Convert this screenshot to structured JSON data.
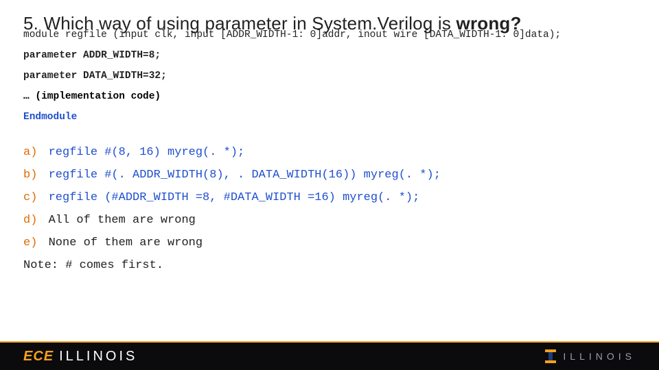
{
  "title": {
    "prefix": "5. Which way of using parameter in System.Verilog is ",
    "emph": "wrong?"
  },
  "code": {
    "sig": "module regfile (input clk, input [ADDR_WIDTH-1: 0]addr, inout wire [DATA_WIDTH-1: 0]data);",
    "param1": "parameter ADDR_WIDTH=8;",
    "param2": "parameter DATA_WIDTH=32;",
    "impl": "… (implementation code)",
    "end": "Endmodule"
  },
  "answers": {
    "a": {
      "label": "a)",
      "body": "regfile #(8, 16) myreg(. *);"
    },
    "b": {
      "label": "b)",
      "body": "regfile #(. ADDR_WIDTH(8), . DATA_WIDTH(16)) myreg(. *);"
    },
    "c": {
      "label": "c)",
      "body": "regfile (#ADDR_WIDTH =8, #DATA_WIDTH =16) myreg(. *);"
    },
    "d": {
      "label": "d)",
      "body": "All of them are wrong"
    },
    "e": {
      "label": "e)",
      "body": "None of them are wrong"
    }
  },
  "note": "Note: # comes first.",
  "footer": {
    "ece": "ECE",
    "illinois": "ILLINOIS",
    "uiuc": "ILLINOIS"
  }
}
